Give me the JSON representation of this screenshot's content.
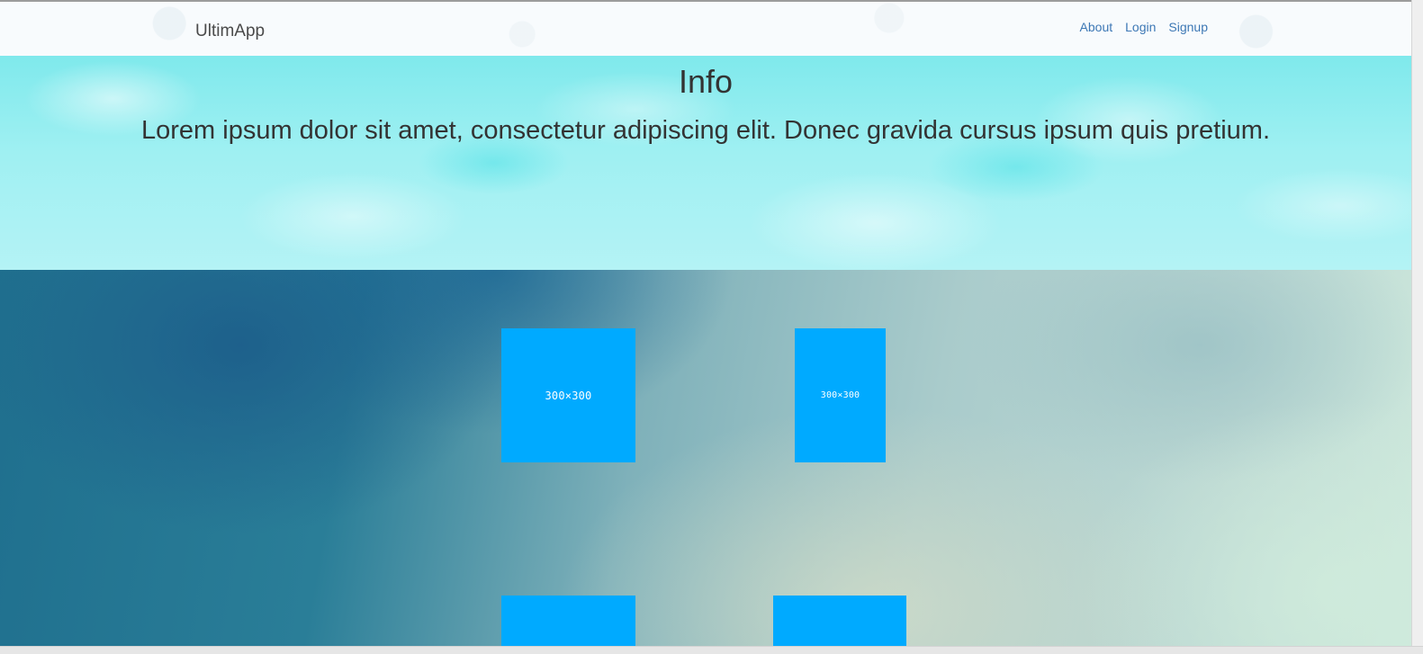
{
  "navbar": {
    "brand": "UltimApp",
    "links": [
      {
        "label": "About"
      },
      {
        "label": "Login"
      },
      {
        "label": "Signup"
      }
    ]
  },
  "hero": {
    "title": "Info",
    "text": "Lorem ipsum dolor sit amet, consectetur adipiscing elit. Donec gravida cursus ipsum quis pretium."
  },
  "thumbnails": [
    {
      "label": "300×300"
    },
    {
      "label": "300×300"
    },
    {
      "label": ""
    },
    {
      "label": ""
    }
  ],
  "colors": {
    "thumbnail": "#00aaff",
    "link": "#3d78b5",
    "hero_text": "#333333"
  }
}
